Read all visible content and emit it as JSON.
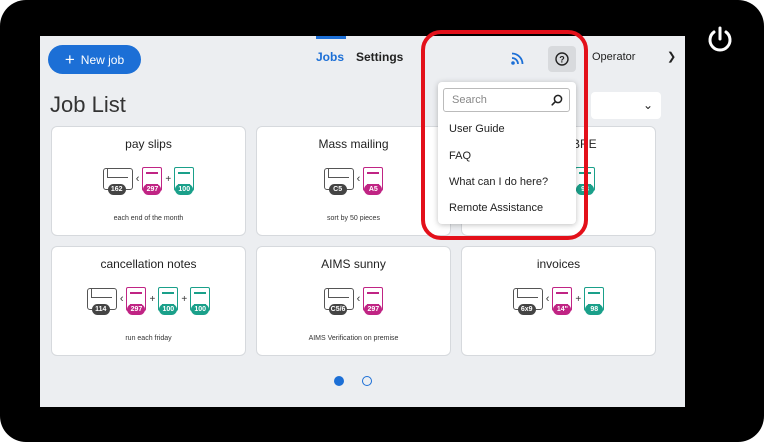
{
  "topbar": {
    "new_job_label": "New job",
    "tabs": [
      "Jobs",
      "Settings"
    ],
    "user": "Operator"
  },
  "page_title": "Job List",
  "help_menu": {
    "search_placeholder": "Search",
    "items": [
      "User Guide",
      "FAQ",
      "What can I do here?",
      "Remote Assistance"
    ]
  },
  "cards": [
    {
      "title": "pay slips",
      "desc": "each end of the month",
      "envelope": "162",
      "docs": [
        {
          "color": "pink",
          "count": "297"
        },
        {
          "color": "teal",
          "count": "100"
        }
      ]
    },
    {
      "title": "Mass mailing",
      "desc": "sort by 50 pieces",
      "envelope": "C5",
      "docs": [
        {
          "color": "pink",
          "count": "A5"
        }
      ]
    },
    {
      "title": "BRE",
      "desc": "",
      "envelope": "",
      "docs": [
        {
          "color": "teal",
          "count": "98"
        }
      ]
    },
    {
      "title": "cancellation notes",
      "desc": "run each friday",
      "envelope": "114",
      "docs": [
        {
          "color": "pink",
          "count": "297"
        },
        {
          "color": "teal",
          "count": "100"
        },
        {
          "color": "teal",
          "count": "100"
        }
      ]
    },
    {
      "title": "AIMS sunny",
      "desc": "AIMS Verification on premise",
      "envelope": "C5/6",
      "docs": [
        {
          "color": "pink",
          "count": "297"
        }
      ]
    },
    {
      "title": "invoices",
      "desc": "",
      "envelope": "6x9",
      "docs": [
        {
          "color": "pink",
          "count": "14\""
        },
        {
          "color": "teal",
          "count": "98"
        }
      ]
    }
  ],
  "pagination": {
    "current": 1,
    "total": 2
  },
  "colors": {
    "accent": "#1c6fd6",
    "highlight": "#e3101a",
    "pink": "#c02484",
    "teal": "#1aa08a"
  }
}
